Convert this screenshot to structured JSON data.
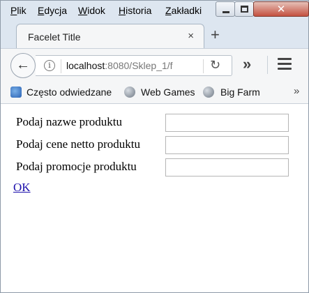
{
  "menubar": {
    "items": [
      {
        "first": "P",
        "rest": "lik"
      },
      {
        "first": "E",
        "rest": "dycja"
      },
      {
        "first": "W",
        "rest": "idok"
      },
      {
        "first": "H",
        "rest": "istoria"
      },
      {
        "first": "Z",
        "rest": "akładki"
      }
    ]
  },
  "window_controls": {
    "close_glyph": "✕"
  },
  "tabs": [
    {
      "title": "Facelet Title",
      "close_glyph": "×"
    }
  ],
  "new_tab_glyph": "+",
  "navbar": {
    "back_glyph": "←",
    "info_glyph": "i",
    "url_host": "localhost",
    "url_rest": ":8080/Sklep_1/f",
    "reload_glyph": "↻",
    "overflow_glyph": "»"
  },
  "bookmarks": [
    {
      "label": "Często odwiedzane",
      "icon": "frequent-icon"
    },
    {
      "label": "Web Games",
      "icon": "globe-icon"
    },
    {
      "label": "Big Farm",
      "icon": "globe-icon"
    }
  ],
  "bookmarks_more_glyph": "»",
  "form": {
    "fields": [
      {
        "label": "Podaj nazwe produktu",
        "value": ""
      },
      {
        "label": "Podaj cene netto produktu",
        "value": ""
      },
      {
        "label": "Podaj promocje produktu",
        "value": ""
      }
    ],
    "submit_label": "OK"
  }
}
